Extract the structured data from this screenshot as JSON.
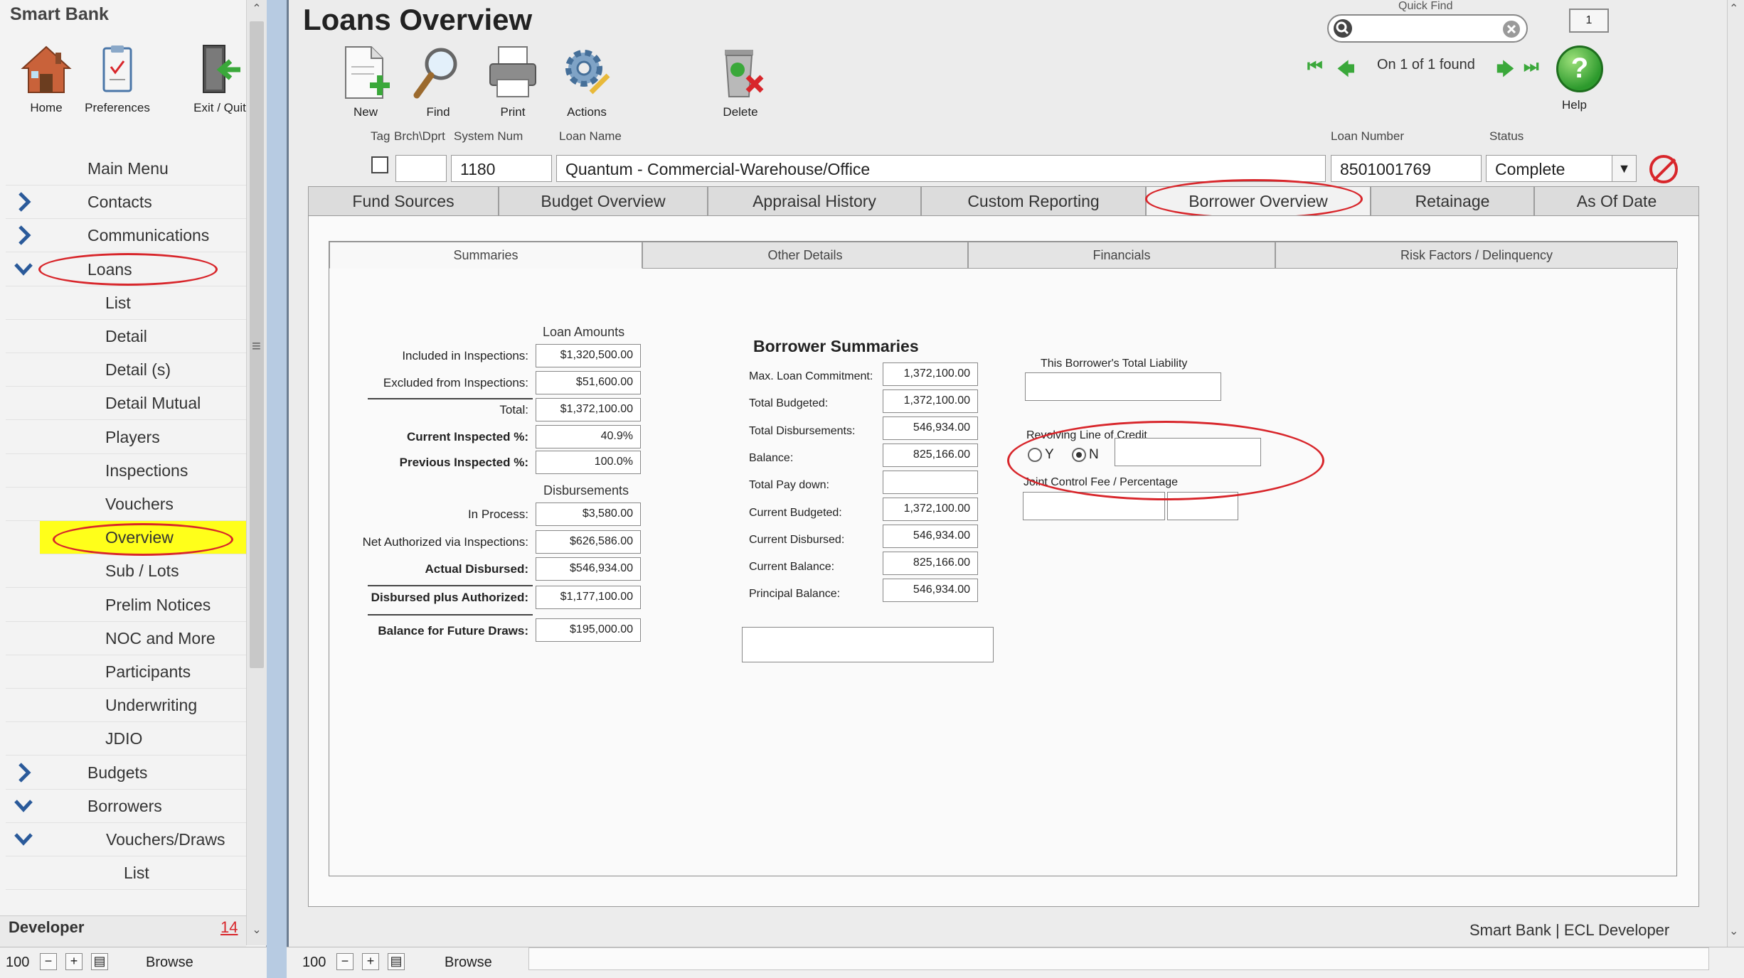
{
  "app": {
    "title": "Smart Bank"
  },
  "sidebar": {
    "tools": [
      {
        "label": "Home",
        "icon": "home-icon"
      },
      {
        "label": "Preferences",
        "icon": "preferences-icon"
      },
      {
        "label": "Exit / Quit",
        "icon": "exit-icon"
      }
    ],
    "menu": [
      {
        "label": "Main Menu"
      },
      {
        "label": "Contacts",
        "chevron": "right"
      },
      {
        "label": "Communications",
        "chevron": "right"
      },
      {
        "label": "Loans",
        "chevron": "down"
      },
      {
        "label": "List"
      },
      {
        "label": "Detail"
      },
      {
        "label": "Detail (s)"
      },
      {
        "label": "Detail Mutual"
      },
      {
        "label": "Players"
      },
      {
        "label": "Inspections"
      },
      {
        "label": "Vouchers"
      },
      {
        "label": "Overview",
        "selected": true
      },
      {
        "label": "Sub / Lots"
      },
      {
        "label": "Prelim Notices"
      },
      {
        "label": "NOC and More"
      },
      {
        "label": "Participants"
      },
      {
        "label": "Underwriting"
      },
      {
        "label": "JDIO"
      },
      {
        "label": "Budgets",
        "chevron": "right"
      },
      {
        "label": "Borrowers",
        "chevron": "down"
      },
      {
        "label": "Vouchers/Draws",
        "chevron": "down"
      },
      {
        "label": "List"
      }
    ],
    "footer": {
      "label": "Developer",
      "count": "14"
    },
    "status": {
      "zoom": "100",
      "mode": "Browse"
    }
  },
  "main": {
    "title": "Loans Overview",
    "toolbar": [
      {
        "label": "New",
        "icon": "new-document-icon"
      },
      {
        "label": "Find",
        "icon": "find-icon"
      },
      {
        "label": "Print",
        "icon": "print-icon"
      },
      {
        "label": "Actions",
        "icon": "actions-gear-icon"
      },
      {
        "label": "Delete",
        "icon": "delete-trash-icon"
      }
    ],
    "quick_find": {
      "label": "Quick Find",
      "value": ""
    },
    "record_badge": "1",
    "nav_found": "On 1 of 1 found",
    "help_label": "Help",
    "header_labels": {
      "tag": "Tag",
      "brch_dprt": "Brch\\Dprt",
      "system_num": "System Num",
      "loan_name": "Loan Name",
      "loan_number": "Loan Number",
      "status": "Status"
    },
    "header_values": {
      "brch_dprt": "",
      "system_num": "1180",
      "loan_name": "Quantum - Commercial-Warehouse/Office",
      "loan_number": "8501001769",
      "status": "Complete"
    },
    "tabs": [
      "Fund Sources",
      "Budget Overview",
      "Appraisal History",
      "Custom Reporting",
      "Borrower Overview",
      "Retainage",
      "As Of Date"
    ],
    "active_tab": "Borrower Overview",
    "subtabs": [
      "Summaries",
      "Other Details",
      "Financials",
      "Risk Factors / Delinquency"
    ],
    "loan_amounts": {
      "heading": "Loan Amounts",
      "rows": [
        {
          "label": "Included in Inspections:",
          "value": "$1,320,500.00"
        },
        {
          "label": "Excluded from Inspections:",
          "value": "$51,600.00"
        },
        {
          "label": "Total:",
          "value": "$1,372,100.00"
        },
        {
          "label": "Current Inspected %:",
          "value": "40.9%"
        },
        {
          "label": "Previous Inspected %:",
          "value": "100.0%"
        }
      ]
    },
    "disbursements": {
      "heading": "Disbursements",
      "rows": [
        {
          "label": "In Process:",
          "value": "$3,580.00"
        },
        {
          "label": "Net Authorized via Inspections:",
          "value": "$626,586.00"
        },
        {
          "label": "Actual Disbursed:",
          "value": "$546,934.00"
        },
        {
          "label": "Disbursed plus Authorized:",
          "value": "$1,177,100.00"
        },
        {
          "label": "Balance for Future Draws:",
          "value": "$195,000.00"
        }
      ]
    },
    "borrower_summaries": {
      "heading": "Borrower Summaries",
      "rows": [
        {
          "label": "Max. Loan Commitment:",
          "value": "1,372,100.00"
        },
        {
          "label": "Total Budgeted:",
          "value": "1,372,100.00"
        },
        {
          "label": "Total Disbursements:",
          "value": "546,934.00"
        },
        {
          "label": "Balance:",
          "value": "825,166.00"
        },
        {
          "label": "Total Pay down:",
          "value": ""
        },
        {
          "label": "Current Budgeted:",
          "value": "1,372,100.00"
        },
        {
          "label": "Current Disbursed:",
          "value": "546,934.00"
        },
        {
          "label": "Current Balance:",
          "value": "825,166.00"
        },
        {
          "label": "Principal Balance:",
          "value": "546,934.00"
        }
      ]
    },
    "liability": {
      "label": "This Borrower's Total Liability",
      "value": ""
    },
    "revolving": {
      "label": "Revolving Line of Credit",
      "yes": "Y",
      "no": "N",
      "selected": "N",
      "value": ""
    },
    "joint_control": {
      "label": "Joint Control Fee / Percentage",
      "fee": "",
      "percentage": ""
    },
    "brand": "Smart Bank | ECL Developer",
    "status": {
      "zoom": "100",
      "mode": "Browse"
    }
  },
  "colors": {
    "annotation": "#d8262b",
    "highlight": "#ffff1a",
    "window_bg": "#b9cde3"
  }
}
